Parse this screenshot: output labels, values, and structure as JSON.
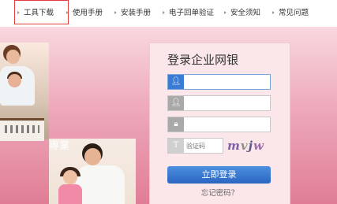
{
  "topnav": {
    "items": [
      {
        "label": "工具下载",
        "active": true
      },
      {
        "label": "使用手册",
        "active": false
      },
      {
        "label": "安装手册",
        "active": false
      },
      {
        "label": "电子回单验证",
        "active": false
      },
      {
        "label": "安全须知",
        "active": false
      },
      {
        "label": "常见问题",
        "active": false
      }
    ]
  },
  "hero": {
    "photo_caption": "專業"
  },
  "login": {
    "title": "登录企业网银",
    "fields": [
      {
        "icon": "user-icon",
        "value": "",
        "placeholder": ""
      },
      {
        "icon": "user-icon",
        "value": "",
        "placeholder": ""
      },
      {
        "icon": "lock-icon",
        "value": "",
        "placeholder": ""
      }
    ],
    "captcha": {
      "icon": "text-icon",
      "placeholder": "验证码",
      "image_text": [
        "m",
        "v",
        "j",
        "w",
        ""
      ]
    },
    "submit_label": "立即登录",
    "forgot_label": "忘记密码？"
  },
  "colors": {
    "accent": "#2b66c2",
    "active_border": "#e53b3b",
    "hero_bg": "#eeaabc",
    "panel_bg": "#fbe6ea"
  }
}
